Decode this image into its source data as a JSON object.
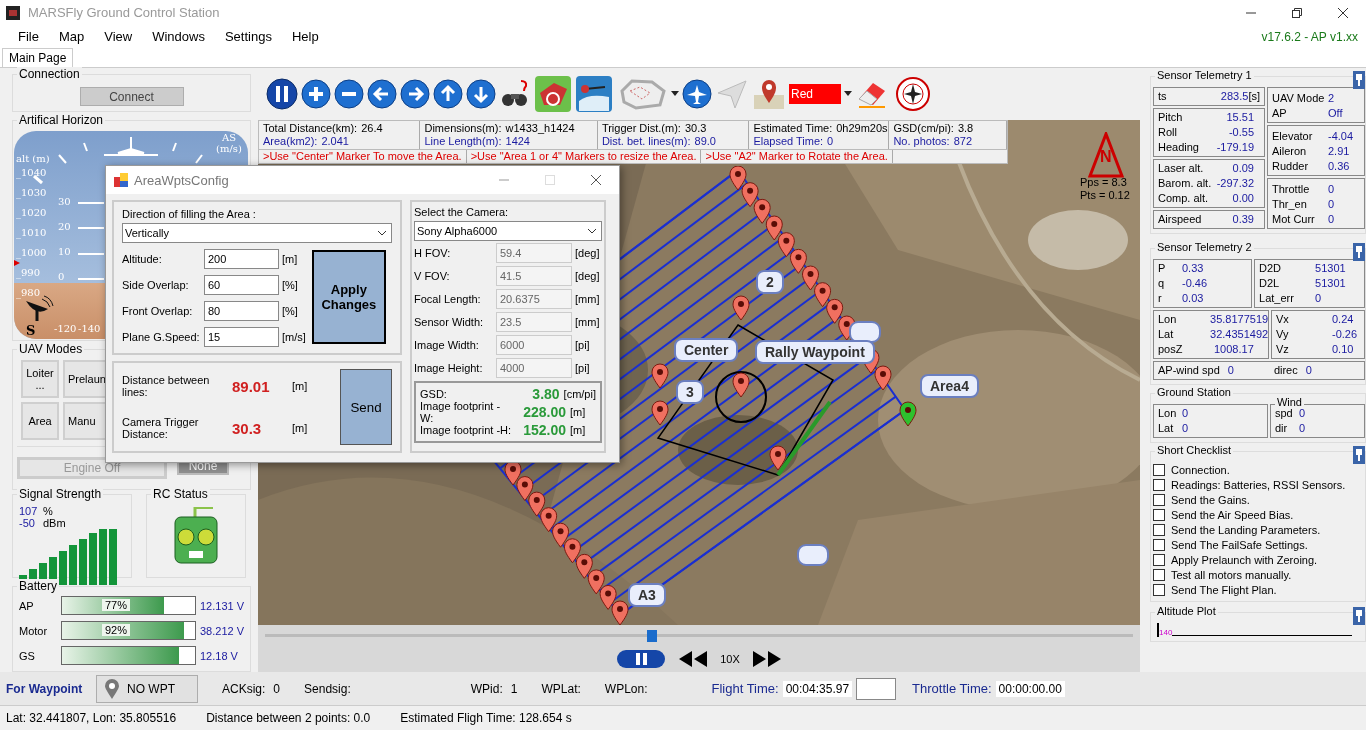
{
  "window": {
    "title": "MARSFly Ground Control Station"
  },
  "menu": [
    "File",
    "Map",
    "View",
    "Windows",
    "Settings",
    "Help"
  ],
  "version": "v17.6.2 - AP v1.xx",
  "tabs": [
    {
      "label": "Main Page",
      "selected": true
    }
  ],
  "connection": {
    "title": "Connection",
    "button": "Connect"
  },
  "horizon": {
    "title": "Artifical Horizon",
    "alt_label": "alt (m)",
    "as_label": "AS (m/s)",
    "alt_ticks": [
      "_1040",
      "_1030",
      "_1020",
      "_1010",
      "_1000",
      "_990",
      "_980"
    ],
    "pitch_ticks": [
      "30",
      "20",
      "10",
      "0"
    ],
    "heading_ticks": [
      "-120",
      "-140"
    ],
    "heading_letter": "S"
  },
  "modes": {
    "title": "UAV Modes",
    "buttons": [
      {
        "label": "Loiter ..."
      },
      {
        "label": "Prelaun"
      },
      {
        "label": "Area"
      },
      {
        "label": "Manu"
      }
    ],
    "engine": {
      "label": "Engine Off",
      "disabled": true
    },
    "mode_state": {
      "label": "None",
      "disabled": true
    }
  },
  "signal": {
    "title": "Signal Strength",
    "percent": "107",
    "percent_unit": "%",
    "dbm": "-50",
    "dbm_unit": "dBm"
  },
  "rc": {
    "title": "RC Status"
  },
  "battery": {
    "title": "Battery",
    "rows": [
      {
        "name": "AP",
        "percent": "77%",
        "level": 0.77,
        "voltage": "12.131 V"
      },
      {
        "name": "Motor",
        "percent": "92%",
        "level": 0.92,
        "voltage": "38.212 V"
      },
      {
        "name": "GS",
        "level": 0.88,
        "voltage": "12.18 V"
      }
    ]
  },
  "toolbar": {
    "color_select": "Red"
  },
  "info": [
    {
      "rows": [
        {
          "label": "Total Distance(km):",
          "value": "26.4"
        },
        {
          "label": "Area(km2):",
          "value": "2.041"
        }
      ]
    },
    {
      "rows": [
        {
          "label": "Dimensions(m):",
          "value": "w1433_h1424"
        },
        {
          "label": "Line Length(m):",
          "value": "1424"
        }
      ]
    },
    {
      "rows": [
        {
          "label": "Trigger Dist.(m):",
          "value": "30.3"
        },
        {
          "label": "Dist. bet. lines(m):",
          "value": "89.0"
        }
      ]
    },
    {
      "rows": [
        {
          "label": "Estimated Time:",
          "value": "0h29m20s"
        },
        {
          "label": "Elapsed Time:",
          "value": "0"
        }
      ]
    },
    {
      "rows": [
        {
          "label": "GSD(cm/pi):",
          "value": "3.8"
        },
        {
          "label": "No. photos:",
          "value": "872"
        }
      ]
    }
  ],
  "hints": [
    ">Use \"Center\" Marker To move the Area.",
    ">Use \"Area 1 or 4\" Markers to resize the Area.",
    ">Use \"A2\" Marker to Rotate the Area."
  ],
  "map": {
    "compass": "N",
    "readouts": [
      "Pps = 8.3",
      "Pts = 0.12"
    ],
    "labels": [
      "Center",
      "Rally Waypoint",
      "Area4",
      "A3",
      "2",
      "3"
    ]
  },
  "playback": {
    "level": 0.44,
    "speed": "10X"
  },
  "dialog": {
    "title": "AreaWptsConfig",
    "direction": {
      "label": "Direction of filling the Area :",
      "value": "Vertically"
    },
    "fields": [
      {
        "label": "Altitude:",
        "value": "200",
        "unit": "[m]"
      },
      {
        "label": "Side Overlap:",
        "value": "60",
        "unit": "[%]"
      },
      {
        "label": "Front Overlap:",
        "value": "80",
        "unit": "[%]"
      },
      {
        "label": "Plane G.Speed:",
        "value": "15",
        "unit": "[m/s]"
      }
    ],
    "apply": "Apply Changes",
    "results": [
      {
        "label": "Distance between lines:",
        "value": "89.01",
        "unit": "[m]"
      },
      {
        "label": "Camera Trigger Distance:",
        "value": "30.3",
        "unit": "[m]"
      }
    ],
    "send": "Send",
    "camera": {
      "label": "Select the Camera:",
      "value": "Sony Alpha6000",
      "fields": [
        {
          "label": "H FOV:",
          "value": "59.4",
          "unit": "[deg]",
          "disabled": true
        },
        {
          "label": "V FOV:",
          "value": "41.5",
          "unit": "[deg]",
          "disabled": true
        },
        {
          "label": "Focal Length:",
          "value": "20.6375",
          "unit": "[mm]",
          "disabled": true
        },
        {
          "label": "Sensor Width:",
          "value": "23.5",
          "unit": "[mm]",
          "disabled": true
        },
        {
          "label": "Image Width:",
          "value": "6000",
          "unit": "[pi]",
          "disabled": true
        },
        {
          "label": "Image Height:",
          "value": "4000",
          "unit": "[pi]",
          "disabled": true
        }
      ]
    },
    "footprint": [
      {
        "label": "GSD:",
        "value": "3.80",
        "unit": "[cm/pi]"
      },
      {
        "label": "Image footprint -W:",
        "value": "228.00",
        "unit": "[m]"
      },
      {
        "label": "Image footprint -H:",
        "value": "152.00",
        "unit": "[m]"
      }
    ]
  },
  "telemetry1": {
    "title": "Sensor Telemetry 1",
    "left": [
      [
        {
          "label": "ts",
          "value": "283.5",
          "unit": "[s]"
        }
      ],
      [
        {
          "label": "Pitch",
          "value": "15.51"
        },
        {
          "label": "Roll",
          "value": "-0.55"
        },
        {
          "label": "Heading",
          "value": "-179.19"
        }
      ],
      [
        {
          "label": "Laser alt.",
          "value": "0.09"
        },
        {
          "label": "Barom. alt.",
          "value": "-297.32"
        },
        {
          "label": "Comp. alt.",
          "value": "0.00"
        }
      ],
      [
        {
          "label": "Airspeed",
          "value": "0.39"
        }
      ]
    ],
    "right": [
      [
        {
          "label": "UAV Mode",
          "value": "2"
        },
        {
          "label": "AP",
          "value": "Off"
        }
      ],
      [
        {
          "label": "Elevator",
          "value": "-4.04"
        },
        {
          "label": "Aileron",
          "value": "2.91"
        },
        {
          "label": "Rudder",
          "value": "0.36"
        }
      ],
      [
        {
          "label": "Throttle",
          "value": "0"
        },
        {
          "label": "Thr_en",
          "value": "0"
        },
        {
          "label": "Mot Curr",
          "value": "0"
        }
      ]
    ]
  },
  "telemetry2": {
    "title": "Sensor Telemetry 2",
    "grid": [
      [
        [
          {
            "label": "P",
            "value": "0.33"
          },
          {
            "label": "q",
            "value": "-0.46"
          },
          {
            "label": "r",
            "value": "0.03"
          }
        ],
        [
          {
            "label": "D2D",
            "value": "51301"
          },
          {
            "label": "D2L",
            "value": "51301"
          },
          {
            "label": "Lat_err",
            "value": "0"
          }
        ]
      ],
      [
        [
          {
            "label": "Lon",
            "value": "35.8177519"
          },
          {
            "label": "Lat",
            "value": "32.4351492"
          },
          {
            "label": "posZ",
            "value": "1008.17"
          }
        ],
        [
          {
            "label": "Vx",
            "value": "0.24"
          },
          {
            "label": "Vy",
            "value": "-0.26"
          },
          {
            "label": "Vz",
            "value": "0.10"
          }
        ]
      ]
    ],
    "wind_row": [
      {
        "label": "AP-wind  spd",
        "value": "0"
      },
      {
        "label": "direc",
        "value": "0"
      }
    ]
  },
  "ground_station": {
    "title": "Ground Station",
    "position": [
      {
        "label": "Lon",
        "value": "0"
      },
      {
        "label": "Lat",
        "value": "0"
      }
    ],
    "wind_title": "Wind",
    "wind": [
      {
        "label": "spd",
        "value": "0"
      },
      {
        "label": "dir",
        "value": "0"
      }
    ]
  },
  "checklist": {
    "title": "Short Checklist",
    "items": [
      {
        "label": "Connection.",
        "checked": false
      },
      {
        "label": "Readings: Batteries, RSSI  Sensors.",
        "checked": false
      },
      {
        "label": "Send the Gains.",
        "checked": false
      },
      {
        "label": "Send the Air Speed Bias.",
        "checked": false
      },
      {
        "label": "Send the Landing Parameters.",
        "checked": false
      },
      {
        "label": "Send The FailSafe Settings.",
        "checked": false
      },
      {
        "label": "Apply Prelaunch with Zeroing.",
        "checked": false
      },
      {
        "label": "Test all motors manually.",
        "checked": false
      },
      {
        "label": "Send The Flight Plan.",
        "checked": false
      }
    ]
  },
  "altitude_plot": {
    "title": "Altitude Plot",
    "tick": "140"
  },
  "waypoint_bar": {
    "title": "For Waypoint",
    "button": "NO WPT",
    "fields": [
      {
        "label": "ACKsig:",
        "value": "0"
      },
      {
        "label": "Sendsig:"
      },
      {
        "label": "WPid:",
        "value": "1"
      },
      {
        "label": "WPLat:"
      },
      {
        "label": "WPLon:"
      }
    ],
    "flight_time": {
      "label": "Flight Time:",
      "value": "00:04:35.97"
    },
    "throttle_time": {
      "label": "Throttle Time:",
      "value": "00:00:00.00"
    }
  },
  "status_bar": [
    "Lat: 32.441807, Lon: 35.805516",
    "Distance between 2 points:  0.0",
    "Estimated Fligh Time:  128.654 s"
  ]
}
